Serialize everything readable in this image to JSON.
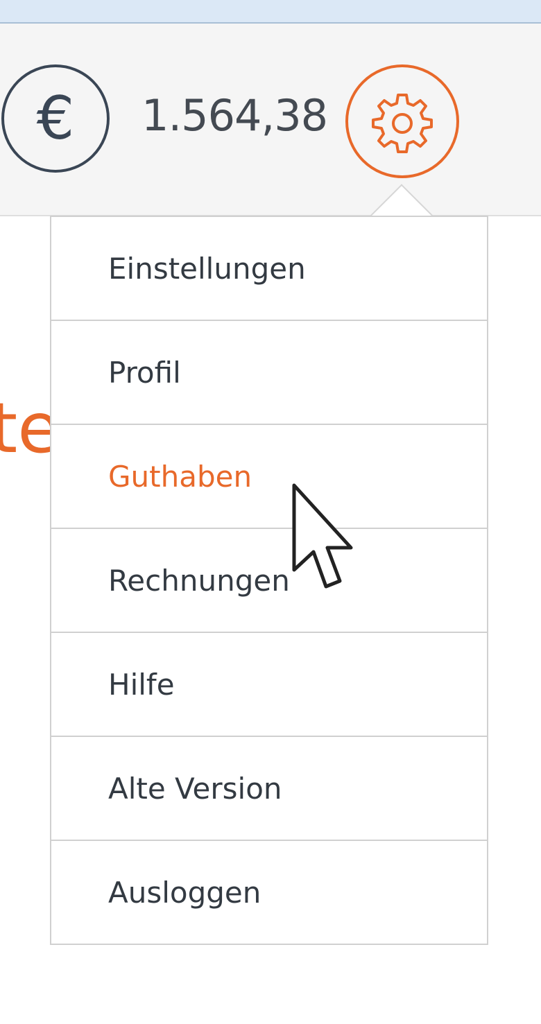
{
  "header": {
    "currency_symbol": "€",
    "balance": "1.564,38"
  },
  "background": {
    "partial_text": "te"
  },
  "menu": {
    "items": [
      {
        "label": "Einstellungen"
      },
      {
        "label": "Profil"
      },
      {
        "label": "Guthaben"
      },
      {
        "label": "Rechnungen"
      },
      {
        "label": "Hilfe"
      },
      {
        "label": "Alte Version"
      },
      {
        "label": "Ausloggen"
      }
    ],
    "active_label": "Guthaben"
  },
  "colors": {
    "accent": "#e8692a",
    "text": "#333a42",
    "header_bg": "#f5f5f5",
    "top_strip": "#dbe8f6"
  },
  "icons": {
    "currency": "euro-icon",
    "settings": "gear-icon",
    "pointer": "mouse-cursor-icon"
  }
}
